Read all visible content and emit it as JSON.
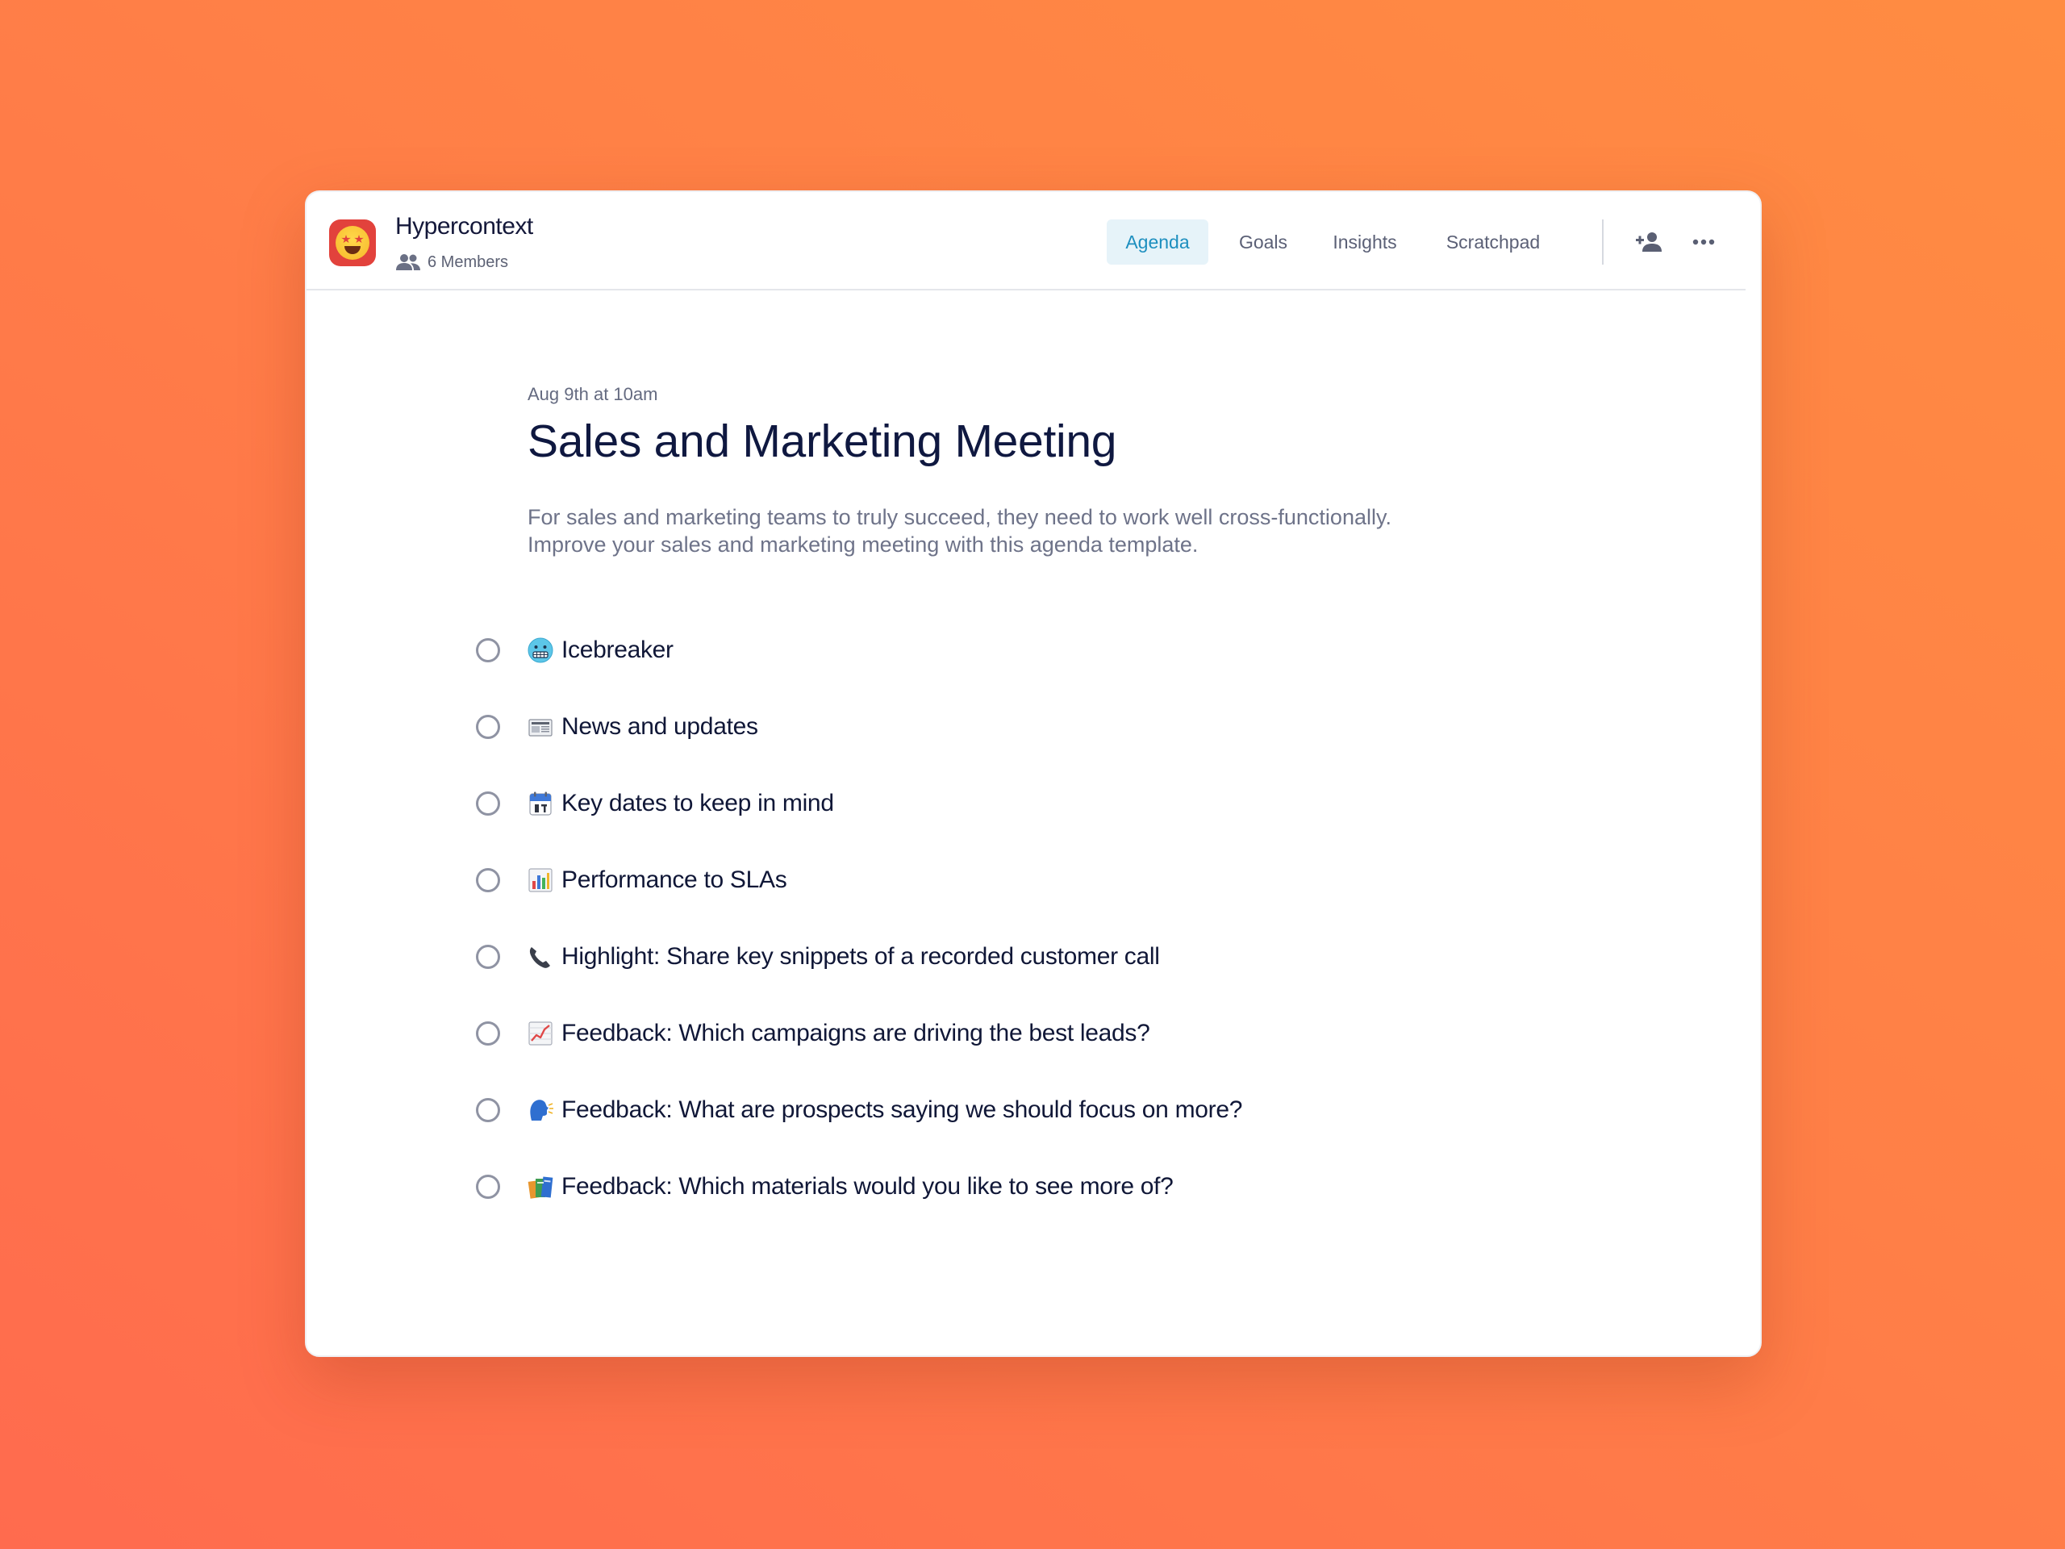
{
  "header": {
    "app_name": "Hypercontext",
    "members_label": "6 Members",
    "logo_icon": "star-struck-emoji-icon"
  },
  "nav": {
    "tabs": [
      {
        "label": "Agenda",
        "active": true
      },
      {
        "label": "Goals",
        "active": false
      },
      {
        "label": "Insights",
        "active": false
      },
      {
        "label": "Scratchpad",
        "active": false
      }
    ],
    "actions": [
      "add-member-icon",
      "more-options-icon"
    ]
  },
  "meeting": {
    "date": "Aug 9th at 10am",
    "title": "Sales and Marketing Meeting",
    "description_line1": "For sales and marketing teams to truly succeed, they need to work well cross-functionally.",
    "description_line2": "Improve your sales and marketing meeting with this agenda template."
  },
  "agenda": {
    "items": [
      {
        "icon": "cold-face-emoji-icon",
        "label": "Icebreaker",
        "done": false
      },
      {
        "icon": "newspaper-emoji-icon",
        "label": "News and updates",
        "done": false
      },
      {
        "icon": "calendar-emoji-icon",
        "label": "Key dates to keep in mind",
        "done": false
      },
      {
        "icon": "bar-chart-emoji-icon",
        "label": "Performance to SLAs",
        "done": false
      },
      {
        "icon": "telephone-emoji-icon",
        "label": "Highlight: Share key snippets of a recorded customer call",
        "done": false
      },
      {
        "icon": "chart-increasing-emoji-icon",
        "label": "Feedback: Which campaigns are driving the best leads?",
        "done": false
      },
      {
        "icon": "speaking-head-emoji-icon",
        "label": "Feedback: What are prospects saying we should focus on more?",
        "done": false
      },
      {
        "icon": "books-emoji-icon",
        "label": "Feedback: Which materials would you like to see more of?",
        "done": false
      }
    ]
  },
  "colors": {
    "accent": "#1d8fbf",
    "accent_bg": "#e6f3f9",
    "title_text": "#0f1840",
    "muted_text": "#6e7389",
    "background_top_right": "#ff8c42",
    "background_bottom_left": "#ff6b4e"
  }
}
